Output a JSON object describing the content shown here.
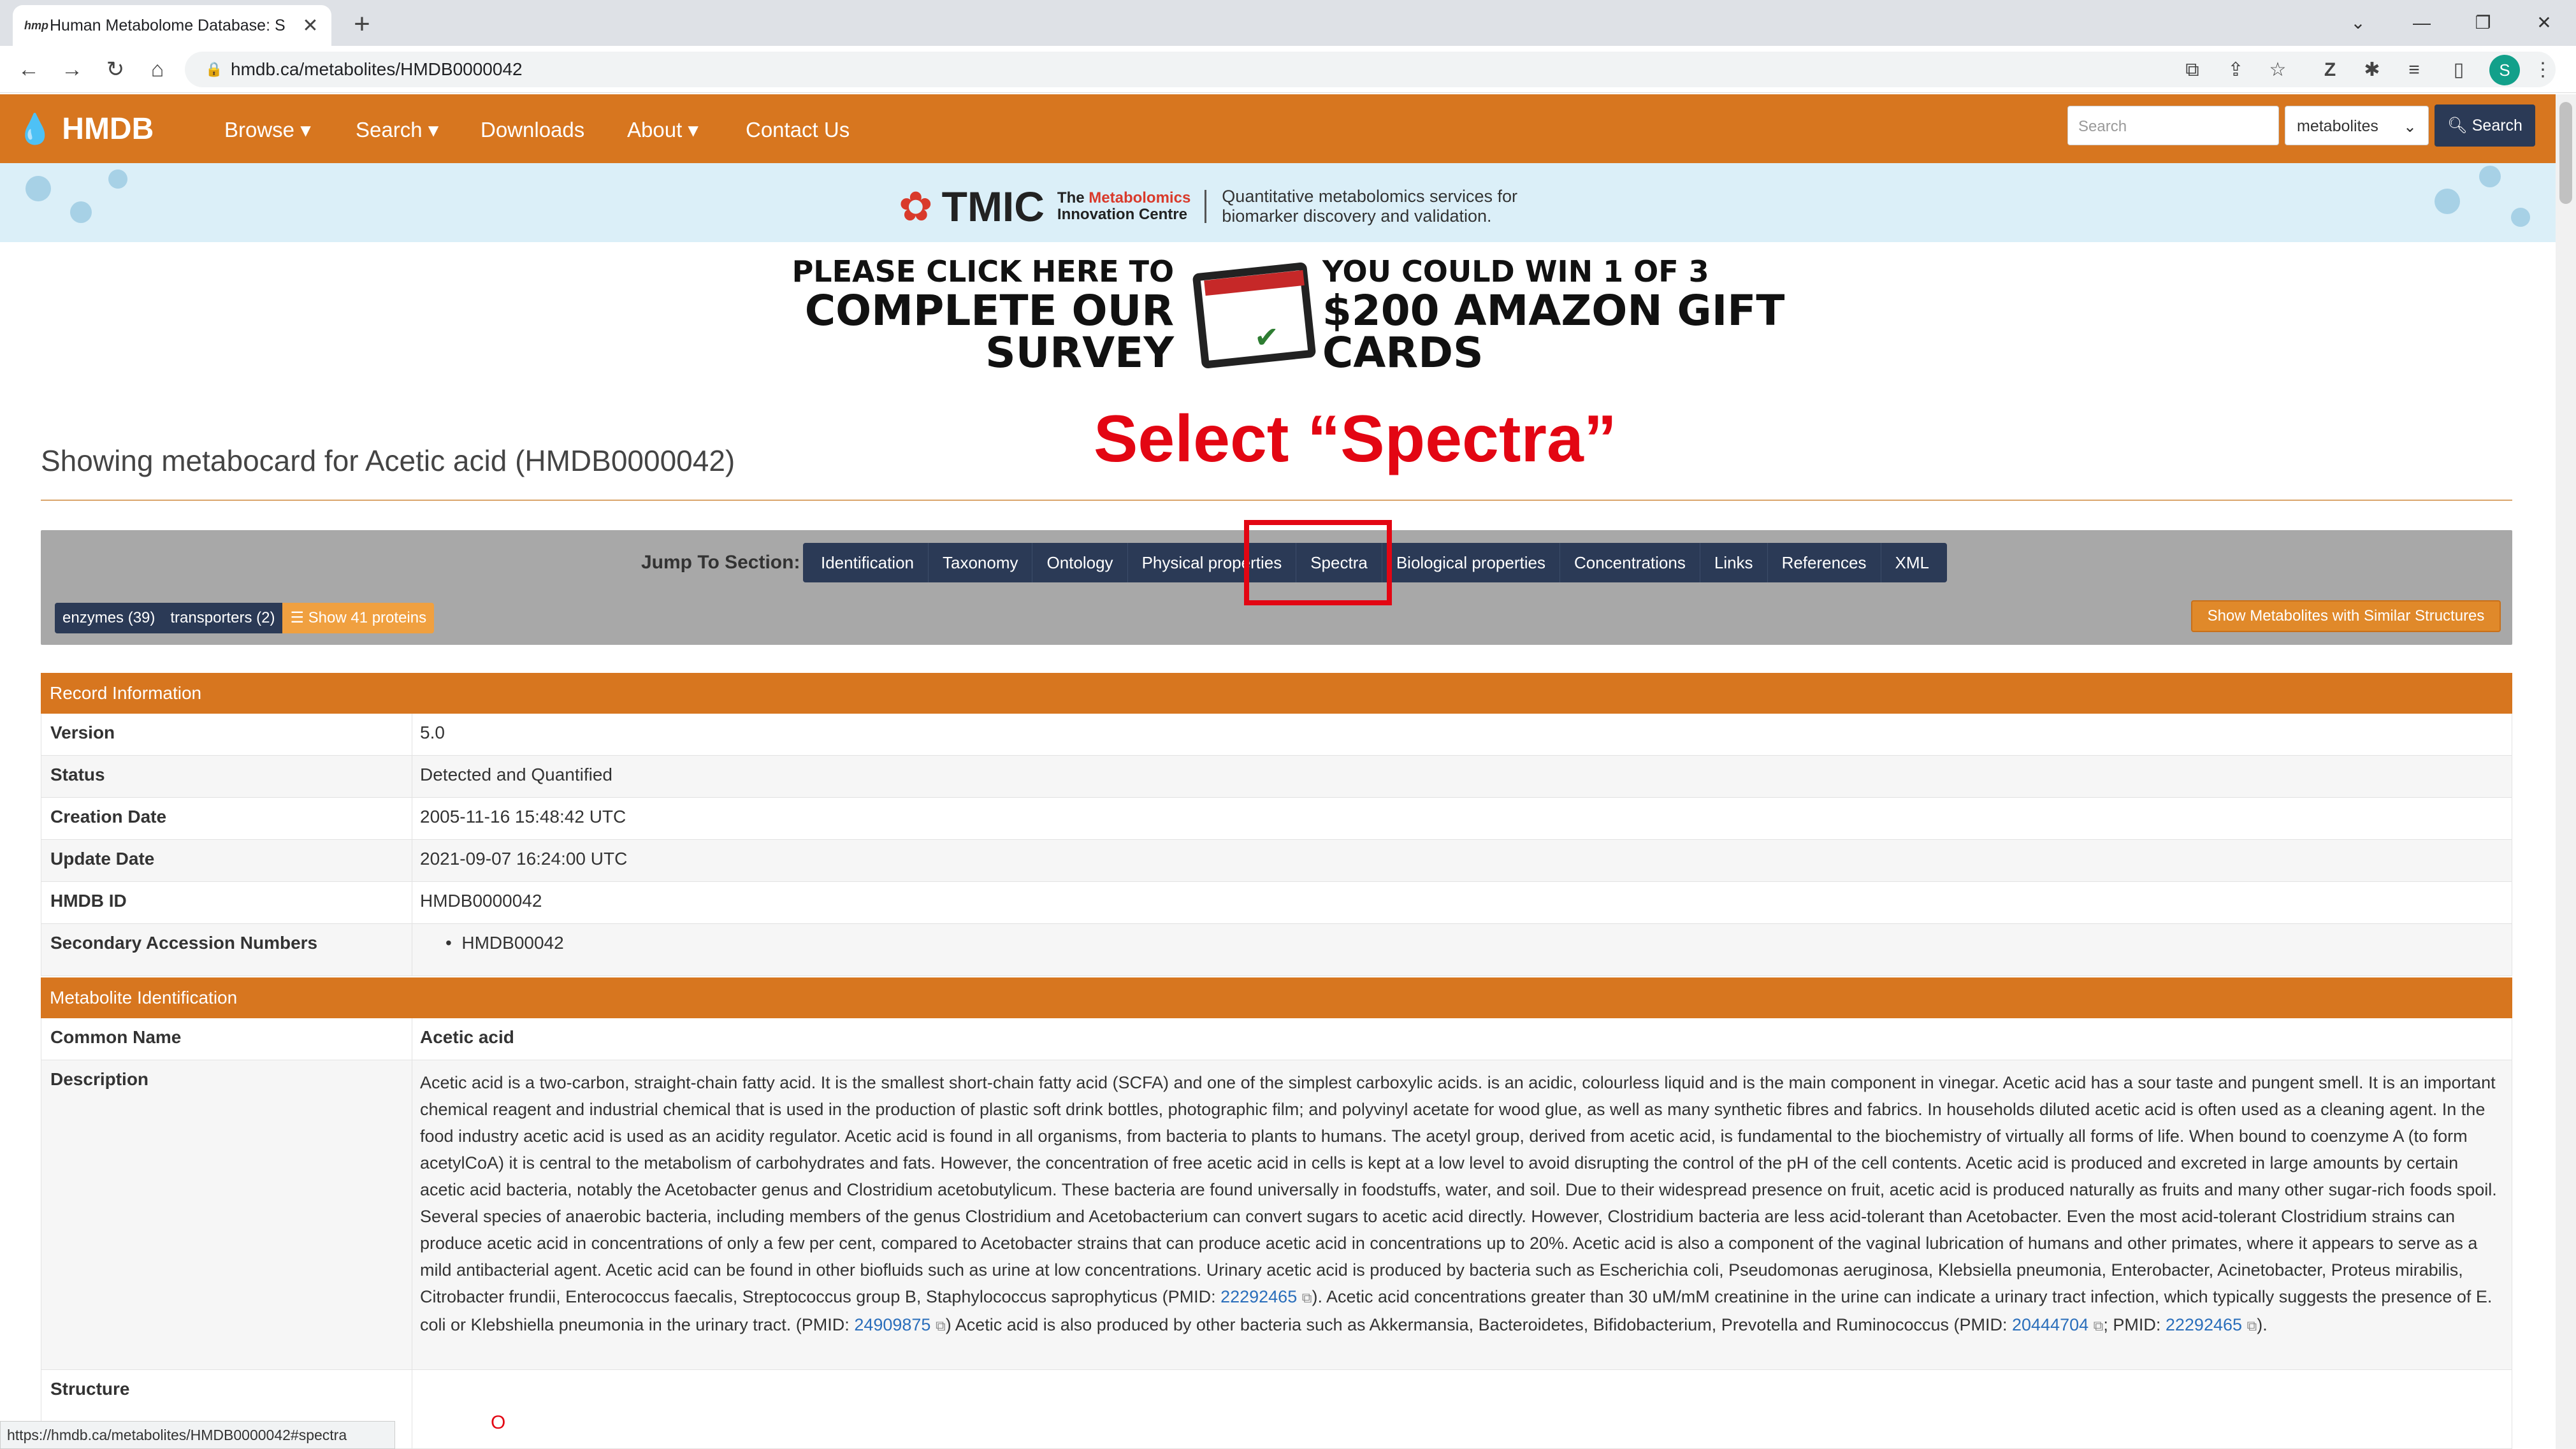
{
  "browser": {
    "tab_title": "Human Metabolome Database: S",
    "tab_favicon": "hmp",
    "url": "hmdb.ca/metabolites/HMDB0000042",
    "profile_initial": "S",
    "status_url": "https://hmdb.ca/metabolites/HMDB0000042#spectra"
  },
  "nav": {
    "brand": "HMDB",
    "items": [
      "Browse",
      "Search",
      "Downloads",
      "About",
      "Contact Us"
    ],
    "search_placeholder": "Search",
    "search_scope": "metabolites",
    "search_button": "Search"
  },
  "tmic_banner": {
    "name": "TMIC",
    "sub_line1_prefix": "The ",
    "sub_line1_highlight": "Metabolomics",
    "sub_line2": "Innovation Centre",
    "tagline_line1": "Quantitative metabolomics services for",
    "tagline_line2": "biomarker discovery and validation."
  },
  "survey_banner": {
    "left_line1": "PLEASE CLICK HERE TO",
    "left_line2": "COMPLETE OUR SURVEY",
    "right_line1": "YOU COULD WIN 1 OF 3",
    "right_line2": "$200 AMAZON GIFT CARDS"
  },
  "page": {
    "title": "Showing metabocard for Acetic acid (HMDB0000042)",
    "instruction": "Select “Spectra”"
  },
  "jump": {
    "label": "Jump To Section:",
    "sections": [
      "Identification",
      "Taxonomy",
      "Ontology",
      "Physical properties",
      "Spectra",
      "Biological properties",
      "Concentrations",
      "Links",
      "References",
      "XML"
    ],
    "enzymes": "enzymes (39)",
    "transporters": "transporters (2)",
    "show_proteins": "Show 41 proteins",
    "similar_button": "Show Metabolites with Similar Structures"
  },
  "record": {
    "heading": "Record Information",
    "rows": [
      {
        "key": "Version",
        "value": "5.0"
      },
      {
        "key": "Status",
        "value": "Detected and Quantified"
      },
      {
        "key": "Creation Date",
        "value": "2005-11-16 15:48:42 UTC"
      },
      {
        "key": "Update Date",
        "value": "2021-09-07 16:24:00 UTC"
      },
      {
        "key": "HMDB ID",
        "value": "HMDB0000042"
      },
      {
        "key": "Secondary Accession Numbers",
        "value": "HMDB00042"
      }
    ]
  },
  "identification": {
    "heading": "Metabolite Identification",
    "common_name_key": "Common Name",
    "common_name": "Acetic acid",
    "description_key": "Description",
    "description_main": "Acetic acid is a two-carbon, straight-chain fatty acid. It is the smallest short-chain fatty acid (SCFA) and one of the simplest carboxylic acids. is an acidic, colourless liquid and is the main component in vinegar. Acetic acid has a sour taste and pungent smell. It is an important chemical reagent and industrial chemical that is used in the production of plastic soft drink bottles, photographic film; and polyvinyl acetate for wood glue, as well as many synthetic fibres and fabrics. In households diluted acetic acid is often used as a cleaning agent. In the food industry acetic acid is used as an acidity regulator. Acetic acid is found in all organisms, from bacteria to plants to humans. The acetyl group, derived from acetic acid, is fundamental to the biochemistry of virtually all forms of life. When bound to coenzyme A (to form acetylCoA) it is central to the metabolism of carbohydrates and fats. However, the concentration of free acetic acid in cells is kept at a low level to avoid disrupting the control of the pH of the cell contents. Acetic acid is produced and excreted in large amounts by certain acetic acid bacteria, notably the Acetobacter genus and Clostridium acetobutylicum. These bacteria are found universally in foodstuffs, water, and soil. Due to their widespread presence on fruit, acetic acid is produced naturally as fruits and many other sugar-rich foods spoil. Several species of anaerobic bacteria, including members of the genus Clostridium and Acetobacterium can convert sugars to acetic acid directly. However, Clostridium bacteria are less acid-tolerant than Acetobacter. Even the most acid-tolerant Clostridium strains can produce acetic acid in concentrations of only a few per cent, compared to Acetobacter strains that can produce acetic acid in concentrations up to 20%. Acetic acid is also a component of the vaginal lubrication of humans and other primates, where it appears to serve as a mild antibacterial agent. Acetic acid can be found in other biofluids such as urine at low concentrations. Urinary acetic acid is produced by bacteria such as Escherichia coli, Pseudomonas aeruginosa, Klebsiella pneumonia, Enterobacter, Acinetobacter, Proteus mirabilis, Citrobacter frundii, Enterococcus faecalis, Streptococcus group B, Staphylococcus saprophyticus (PMID: ",
    "pmid1": "22292465",
    "description_mid": "). Acetic acid concentrations greater than 30 uM/mM creatinine in the urine can indicate a urinary tract infection, which typically suggests the presence of E. coli or Klebshiella pneumonia in the urinary tract. (PMID: ",
    "pmid2": "24909875",
    "description_end": ") Acetic acid is also produced by other bacteria such as Akkermansia, Bacteroidetes, Bifidobacterium, Prevotella and Ruminococcus (PMID: ",
    "pmid3": "20444704",
    "sep": "; PMID: ",
    "pmid4": "22292465",
    "close": ").",
    "structure_key": "Structure",
    "structure_glyph": "O"
  }
}
